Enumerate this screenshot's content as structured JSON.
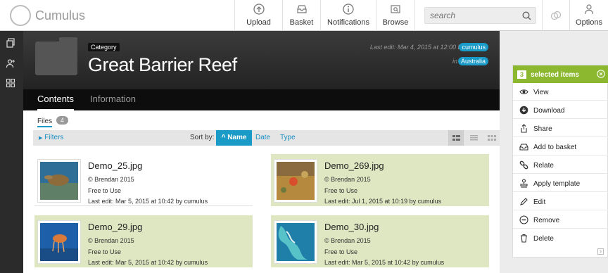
{
  "app": {
    "name": "Cumulus"
  },
  "topnav": {
    "items": [
      {
        "label": "Upload",
        "icon": "upload-icon"
      },
      {
        "label": "Basket",
        "icon": "basket-icon"
      },
      {
        "label": "Notifications",
        "icon": "info-icon"
      },
      {
        "label": "Browse",
        "icon": "browse-icon"
      }
    ],
    "search_placeholder": "search",
    "options_label": "Options"
  },
  "header": {
    "category_tag": "Category",
    "title": "Great Barrier Reef",
    "last_edit": "Last edit: Mar 4, 2015 at 12:00 by",
    "last_edit_user": "cumulus",
    "in_label": "in",
    "location": "Australia"
  },
  "tabs": {
    "contents": "Contents",
    "information": "Information"
  },
  "files": {
    "label": "Files",
    "count": "4"
  },
  "toolbar": {
    "filters": "Filters",
    "sort_by": "Sort by:",
    "sort_name": "Name",
    "sort_date": "Date",
    "sort_type": "Type"
  },
  "cards": [
    {
      "name": "Demo_25.jpg",
      "copyright": "© Brendan 2015",
      "rights": "Free to Use",
      "last_edit": "Last edit: Mar 5, 2015 at 10:42 by cumulus",
      "selected": false
    },
    {
      "name": "Demo_269.jpg",
      "copyright": "© Brendan 2015",
      "rights": "Free to Use",
      "last_edit": "Last edit: Jul 1, 2015 at 10:19 by cumulus",
      "selected": true
    },
    {
      "name": "Demo_29.jpg",
      "copyright": "© Brendan 2015",
      "rights": "Free to Use",
      "last_edit": "Last edit: Mar 5, 2015 at 10:42 by cumulus",
      "selected": true
    },
    {
      "name": "Demo_30.jpg",
      "copyright": "© Brendan 2015",
      "rights": "Free to Use",
      "last_edit": "Last edit: Mar 5, 2015 at 10:42 by cumulus",
      "selected": true
    }
  ],
  "selection": {
    "count": "3",
    "label": "selected items",
    "actions": [
      {
        "label": "View",
        "icon": "eye-icon"
      },
      {
        "label": "Download",
        "icon": "download-icon"
      },
      {
        "label": "Share",
        "icon": "share-icon"
      },
      {
        "label": "Add to basket",
        "icon": "basket-icon"
      },
      {
        "label": "Relate",
        "icon": "link-icon"
      },
      {
        "label": "Apply template",
        "icon": "stamp-icon"
      },
      {
        "label": "Edit",
        "icon": "pencil-icon"
      },
      {
        "label": "Remove",
        "icon": "minus-circle-icon"
      },
      {
        "label": "Delete",
        "icon": "trash-icon"
      }
    ]
  },
  "colors": {
    "accent": "#1a9ac6",
    "selection": "#8bb82e",
    "selected_card": "#dfe7c2"
  }
}
